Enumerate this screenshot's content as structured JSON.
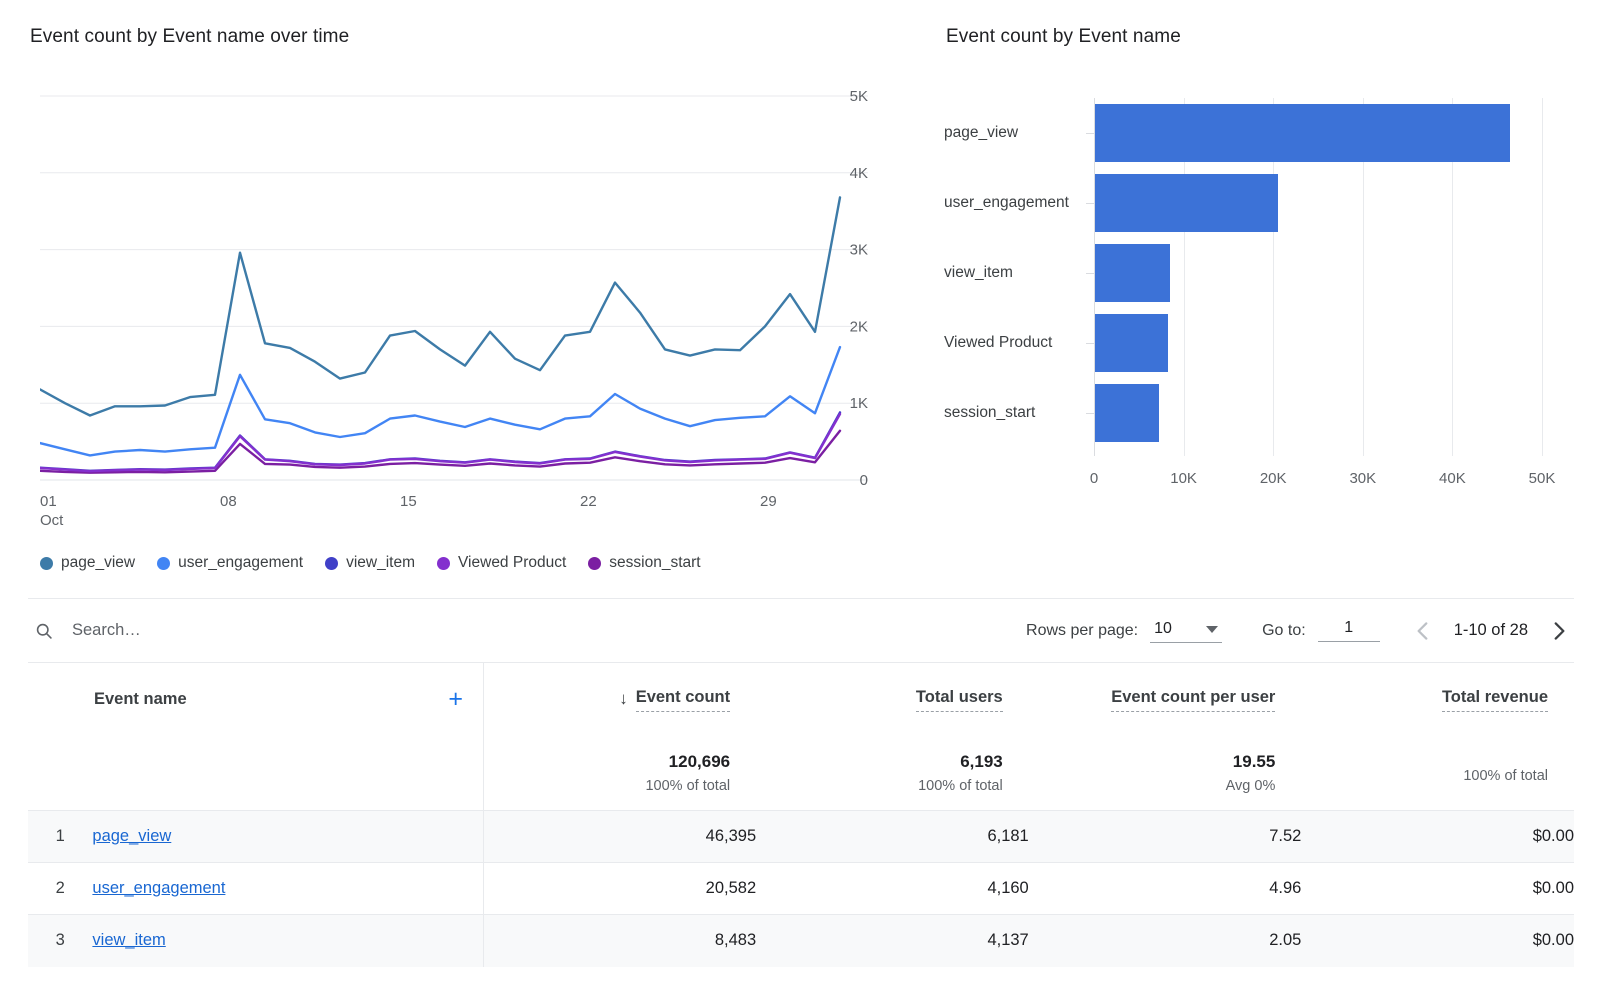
{
  "line_card": {
    "title": "Event count by Event name over time"
  },
  "bar_card": {
    "title": "Event count by Event name"
  },
  "toolbar": {
    "search_placeholder": "Search…",
    "search_value": "",
    "search_icon": "search-icon",
    "rows_per_page_label": "Rows per page:",
    "rows_per_page_value": "10",
    "goto_label": "Go to:",
    "goto_value": "1",
    "range_text": "1-10 of 28",
    "prev_icon": "chevron-left-icon",
    "next_icon": "chevron-right-icon"
  },
  "table": {
    "headers": {
      "event_name": "Event name",
      "add_icon": "plus-icon",
      "sort_icon": "arrow-down-icon",
      "event_count": "Event count",
      "total_users": "Total users",
      "event_count_per_user": "Event count per user",
      "total_revenue": "Total revenue"
    },
    "totals": {
      "event_count": "120,696",
      "event_count_sub": "100% of total",
      "total_users": "6,193",
      "total_users_sub": "100% of total",
      "event_count_per_user": "19.55",
      "event_count_per_user_sub": "Avg 0%",
      "total_revenue": "",
      "total_revenue_sub": "100% of total"
    },
    "rows": [
      {
        "index": "1",
        "name": "page_view",
        "event_count": "46,395",
        "total_users": "6,181",
        "per_user": "7.52",
        "revenue": "$0.00"
      },
      {
        "index": "2",
        "name": "user_engagement",
        "event_count": "20,582",
        "total_users": "4,160",
        "per_user": "4.96",
        "revenue": "$0.00"
      },
      {
        "index": "3",
        "name": "view_item",
        "event_count": "8,483",
        "total_users": "4,137",
        "per_user": "2.05",
        "revenue": "$0.00"
      }
    ]
  },
  "colors": {
    "page_view": "#3d7ba8",
    "user_engagement": "#4285f4",
    "view_item": "#4040c8",
    "viewed_product": "#8430ce",
    "session_start": "#7b1fa2",
    "bar_fill": "#3c72d7",
    "link": "#1967d2",
    "accent": "#1a73e8",
    "gridline": "#e8eaed"
  },
  "chart_data": [
    {
      "type": "line",
      "title": "Event count by Event name over time",
      "xlabel": "",
      "ylabel": "",
      "ylim": [
        0,
        5000
      ],
      "yticks": [
        "0",
        "1K",
        "2K",
        "3K",
        "4K",
        "5K"
      ],
      "ytick_values": [
        0,
        1000,
        2000,
        3000,
        4000,
        5000
      ],
      "xticks": [
        "01",
        "08",
        "15",
        "22",
        "29"
      ],
      "xtick_sub": [
        "Oct",
        "",
        "",
        "",
        ""
      ],
      "x": [
        1,
        2,
        3,
        4,
        5,
        6,
        7,
        8,
        9,
        10,
        11,
        12,
        13,
        14,
        15,
        16,
        17,
        18,
        19,
        20,
        21,
        22,
        23,
        24,
        25,
        26,
        27,
        28,
        29,
        30,
        31,
        32
      ],
      "grid": true,
      "legend_position": "bottom",
      "series": [
        {
          "name": "page_view",
          "color": "#3d7ba8",
          "values": [
            1180,
            1000,
            840,
            960,
            960,
            970,
            1080,
            1110,
            2960,
            1780,
            1720,
            1540,
            1320,
            1400,
            1880,
            1940,
            1700,
            1490,
            1930,
            1580,
            1430,
            1880,
            1930,
            2570,
            2180,
            1700,
            1620,
            1700,
            1690,
            2000,
            2420,
            1930,
            3680
          ]
        },
        {
          "name": "user_engagement",
          "color": "#4285f4",
          "values": [
            480,
            400,
            320,
            370,
            390,
            370,
            400,
            420,
            1370,
            790,
            740,
            620,
            560,
            610,
            800,
            840,
            760,
            690,
            800,
            720,
            660,
            800,
            830,
            1120,
            930,
            800,
            700,
            780,
            810,
            830,
            1090,
            870,
            1730
          ]
        },
        {
          "name": "view_item",
          "color": "#4040c8",
          "values": [
            160,
            140,
            120,
            130,
            140,
            135,
            150,
            160,
            580,
            270,
            250,
            210,
            200,
            220,
            270,
            280,
            250,
            230,
            270,
            240,
            220,
            270,
            280,
            370,
            310,
            260,
            240,
            260,
            270,
            280,
            360,
            290,
            880
          ]
        },
        {
          "name": "Viewed Product",
          "color": "#8430ce",
          "values": [
            155,
            135,
            115,
            128,
            135,
            130,
            145,
            155,
            570,
            265,
            245,
            205,
            195,
            215,
            265,
            275,
            245,
            225,
            265,
            235,
            215,
            265,
            275,
            365,
            305,
            255,
            235,
            255,
            265,
            275,
            355,
            285,
            860
          ]
        },
        {
          "name": "session_start",
          "color": "#7b1fa2",
          "values": [
            120,
            105,
            95,
            100,
            105,
            100,
            110,
            120,
            470,
            210,
            200,
            170,
            160,
            175,
            210,
            220,
            200,
            185,
            215,
            190,
            175,
            215,
            225,
            295,
            245,
            205,
            190,
            205,
            215,
            225,
            285,
            230,
            640
          ]
        }
      ]
    },
    {
      "type": "bar",
      "orientation": "horizontal",
      "title": "Event count by Event name",
      "categories": [
        "page_view",
        "user_engagement",
        "view_item",
        "Viewed Product",
        "session_start"
      ],
      "values": [
        46395,
        20582,
        8483,
        8286,
        7243
      ],
      "xticks": [
        "0",
        "10K",
        "20K",
        "30K",
        "40K",
        "50K"
      ],
      "xtick_values": [
        0,
        10000,
        20000,
        30000,
        40000,
        50000
      ],
      "xlim": [
        0,
        50000
      ],
      "color": "#3c72d7",
      "grid": true
    }
  ]
}
